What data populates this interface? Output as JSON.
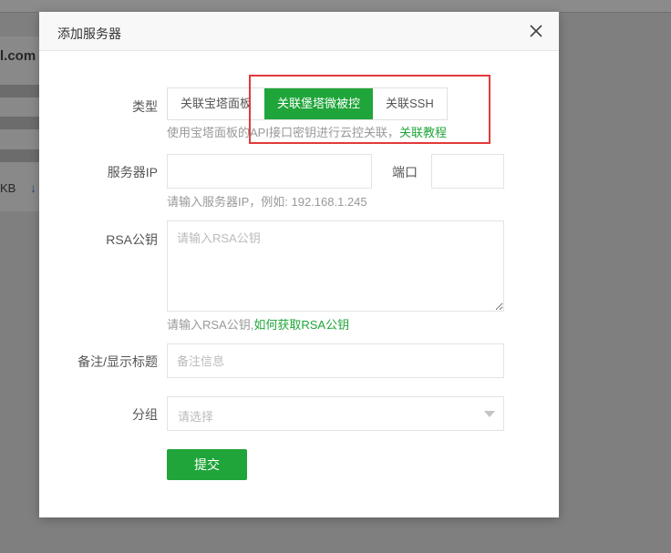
{
  "background": {
    "domain_fragment": "l.com",
    "size_fragment": "KB",
    "arrow_glyph": "↓"
  },
  "dialog": {
    "title": "添加服务器",
    "close_icon": "close-icon"
  },
  "form": {
    "type": {
      "label": "类型",
      "options": [
        "关联宝塔面板",
        "关联堡塔微被控",
        "关联SSH"
      ],
      "selected": "关联堡塔微被控",
      "hint": "使用宝塔面板的API接口密钥进行云控关联，",
      "hint_link": "关联教程"
    },
    "server_ip": {
      "label": "服务器IP",
      "value": "",
      "hint": "请输入服务器IP，例如: 192.168.1.245"
    },
    "port": {
      "label": "端口",
      "value": ""
    },
    "rsa": {
      "label": "RSA公钥",
      "placeholder": "请输入RSA公钥",
      "hint": "请输入RSA公钥,",
      "hint_link": "如何获取RSA公钥"
    },
    "remark": {
      "label": "备注/显示标题",
      "placeholder": "备注信息"
    },
    "group": {
      "label": "分组",
      "placeholder": "请选择"
    },
    "submit_label": "提交"
  },
  "colors": {
    "accent": "#20a53a",
    "highlight": "#e23a3a"
  }
}
